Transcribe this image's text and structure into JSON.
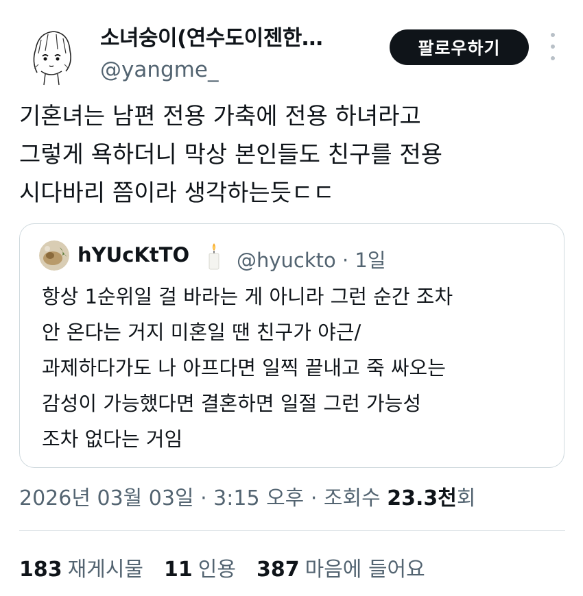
{
  "author": {
    "name": "소녀숭이(연수도이젠한…",
    "handle": "@yangme_"
  },
  "follow_button": "팔로우하기",
  "tweet_lines": [
    "기혼녀는 남편 전용 가축에 전용 하녀라고",
    "그렇게 욕하더니 막상 본인들도 친구를 전용",
    "시다바리 쯤이라 생각하는듯ㄷㄷ"
  ],
  "quote": {
    "name": "hYUcKtTO",
    "meta": "@hyuckto · 1일",
    "lines": [
      "항상 1순위일 걸 바라는 게 아니라 그런 순간 조차",
      "안 온다는 거지 미혼일 땐 친구가 야근/",
      "과제하다가도 나 아프다면 일찍 끝내고 죽 싸오는",
      "감성이 가능했다면 결혼하면 일절 그런 가능성",
      "조차 없다는 거임"
    ]
  },
  "timestamp": {
    "text": "2026년 03월 03일 · 3:15 오후 · 조회수 ",
    "views": "23.3천",
    "views_suffix": "회"
  },
  "stats": {
    "reposts_count": "183",
    "reposts_label": "재게시물",
    "quotes_count": "11",
    "quotes_label": "인용",
    "likes_count": "387",
    "likes_label": "마음에 들어요"
  },
  "icons": {
    "more": "more-vertical-icon",
    "candle": "candle-icon"
  },
  "colors": {
    "text_primary": "#0f1419",
    "text_secondary": "#536471",
    "button_bg": "#0f1419",
    "border": "#cfd9de"
  }
}
